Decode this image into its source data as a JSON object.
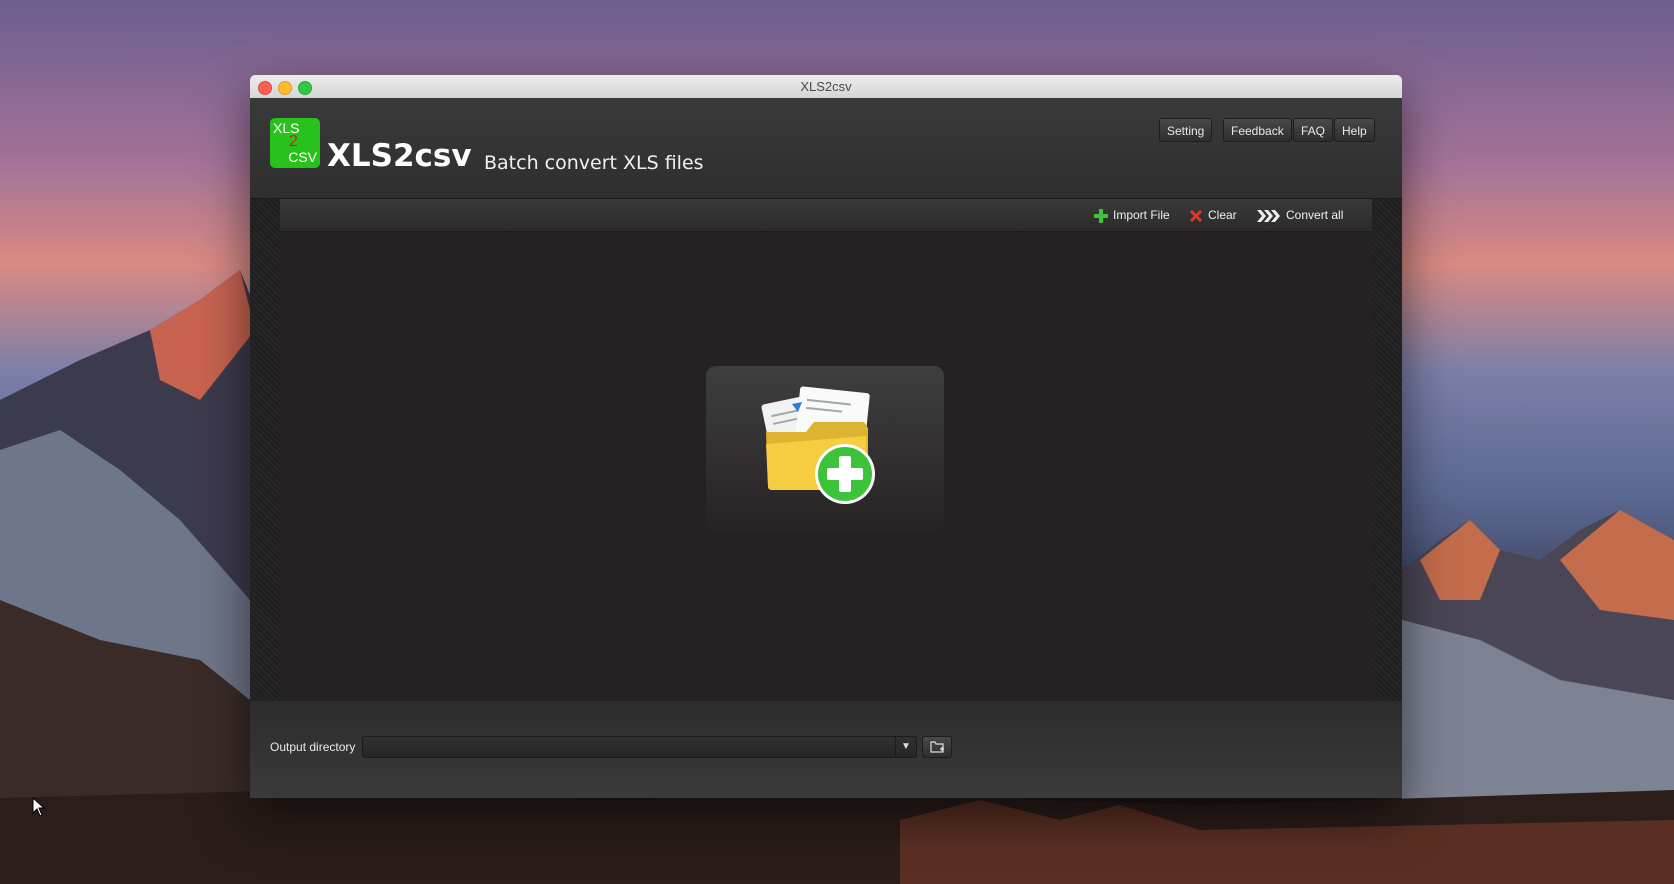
{
  "window": {
    "title": "XLS2csv"
  },
  "header": {
    "logo": {
      "line1": "XLS",
      "line2": "2",
      "line3": "CSV"
    },
    "app_name": "XLS2csv",
    "tagline": "Batch convert XLS files",
    "buttons": {
      "setting": "Setting",
      "feedback": "Feedback",
      "faq": "FAQ",
      "help": "Help"
    }
  },
  "toolbar": {
    "import": "Import File",
    "clear": "Clear",
    "convert": "Convert all"
  },
  "dropzone": {
    "icon": "add-folder-icon"
  },
  "footer": {
    "output_label": "Output directory",
    "output_value": "",
    "browse_icon": "folder-browse-icon"
  },
  "colors": {
    "accent_green": "#29c21d",
    "window_bg": "#2c2b2b",
    "dropzone_bg": "#262223",
    "clear_red": "#e03a2a"
  }
}
